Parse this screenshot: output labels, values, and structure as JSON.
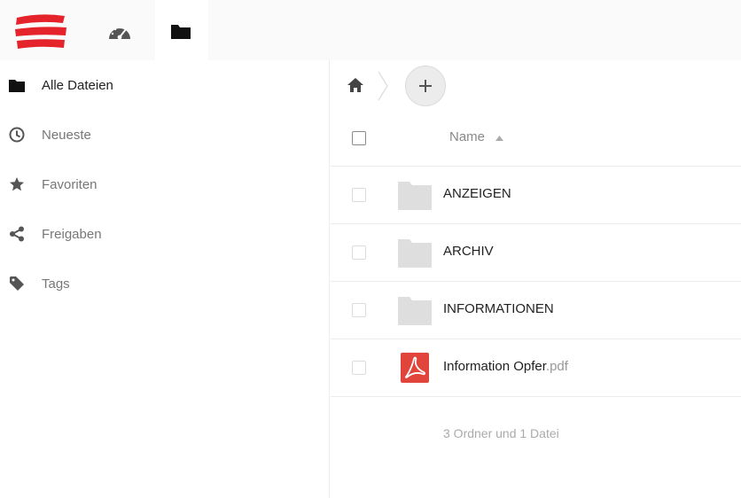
{
  "header": {
    "logo_colors": [
      "#e4242a",
      "#ffffff"
    ],
    "apps": [
      {
        "name": "dashboard",
        "icon": "dashboard-gauge-icon"
      },
      {
        "name": "files",
        "icon": "folder-icon",
        "active": true
      }
    ]
  },
  "sidebar": {
    "items": [
      {
        "label": "Alle Dateien",
        "icon": "folder-icon",
        "active": true
      },
      {
        "label": "Neueste",
        "icon": "clock-icon"
      },
      {
        "label": "Favoriten",
        "icon": "star-icon"
      },
      {
        "label": "Freigaben",
        "icon": "share-icon"
      },
      {
        "label": "Tags",
        "icon": "tag-icon"
      }
    ]
  },
  "main": {
    "breadcrumb": {
      "home_icon": "home-icon",
      "add_icon": "plus-icon"
    },
    "table": {
      "column_name": "Name",
      "sort": "ascending",
      "rows": [
        {
          "name": "ANZEIGEN",
          "ext": "",
          "type": "folder"
        },
        {
          "name": "ARCHIV",
          "ext": "",
          "type": "folder"
        },
        {
          "name": "INFORMATIONEN",
          "ext": "",
          "type": "folder"
        },
        {
          "name": "Information Opfer",
          "ext": ".pdf",
          "type": "pdf"
        }
      ],
      "summary": "3 Ordner und 1 Datei"
    }
  },
  "colors": {
    "brand_red": "#e4242a",
    "folder_gray": "#dedede",
    "pdf_red": "#e0443b",
    "divider": "#ececec"
  }
}
